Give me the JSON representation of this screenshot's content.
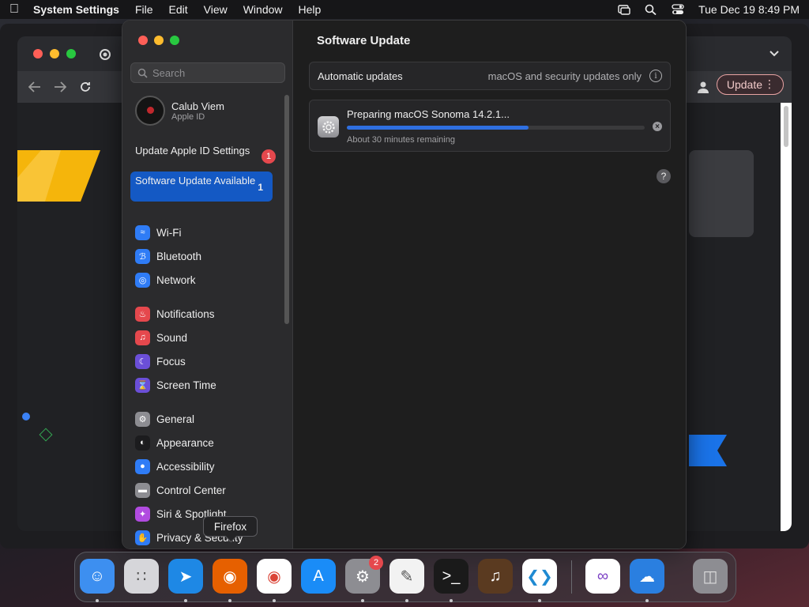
{
  "menubar": {
    "app_name": "System Settings",
    "menus": [
      "File",
      "Edit",
      "View",
      "Window",
      "Help"
    ],
    "datetime": "Tue Dec 19  8:49 PM"
  },
  "chrome": {
    "update_label": "Update"
  },
  "settings": {
    "search_placeholder": "Search",
    "account": {
      "name": "Calub Viem",
      "subtitle": "Apple ID"
    },
    "alerts": [
      {
        "label": "Update Apple ID Settings",
        "count": "1"
      },
      {
        "label": "Software Update Available",
        "count": "1"
      }
    ],
    "nav_groups": [
      [
        {
          "label": "Wi-Fi",
          "icon": "wifi-icon",
          "color": "#2f7cf6"
        },
        {
          "label": "Bluetooth",
          "icon": "bluetooth-icon",
          "color": "#2f7cf6"
        },
        {
          "label": "Network",
          "icon": "globe-icon",
          "color": "#2f7cf6"
        }
      ],
      [
        {
          "label": "Notifications",
          "icon": "bell-icon",
          "color": "#e5484d"
        },
        {
          "label": "Sound",
          "icon": "speaker-icon",
          "color": "#e5484d"
        },
        {
          "label": "Focus",
          "icon": "moon-icon",
          "color": "#6b4fd8"
        },
        {
          "label": "Screen Time",
          "icon": "hourglass-icon",
          "color": "#6b4fd8"
        }
      ],
      [
        {
          "label": "General",
          "icon": "gear-icon",
          "color": "#8d8d92"
        },
        {
          "label": "Appearance",
          "icon": "appearance-icon",
          "color": "#1c1c1e"
        },
        {
          "label": "Accessibility",
          "icon": "accessibility-icon",
          "color": "#2f7cf6"
        },
        {
          "label": "Control Center",
          "icon": "toggles-icon",
          "color": "#8d8d92"
        },
        {
          "label": "Siri & Spotlight",
          "icon": "siri-icon",
          "color": "#b14be0"
        },
        {
          "label": "Privacy & Security",
          "icon": "hand-icon",
          "color": "#2f7cf6"
        }
      ]
    ],
    "main": {
      "title": "Software Update",
      "auto_updates_label": "Automatic updates",
      "auto_updates_value": "macOS and security updates only",
      "progress_title": "Preparing macOS Sonoma 14.2.1...",
      "progress_fraction": 0.61,
      "progress_subtitle": "About 30 minutes remaining"
    }
  },
  "tooltip": "Firefox",
  "dock": {
    "apps": [
      {
        "name": "Finder",
        "icon": "finder-icon",
        "color": "#3d8ff0",
        "running": true
      },
      {
        "name": "Launchpad",
        "icon": "launchpad-icon",
        "color": "#d6d6da",
        "running": false
      },
      {
        "name": "Safari",
        "icon": "safari-icon",
        "color": "#1e88e5",
        "running": true
      },
      {
        "name": "Firefox",
        "icon": "firefox-icon",
        "color": "#e66000",
        "running": true
      },
      {
        "name": "Chrome",
        "icon": "chrome-icon",
        "color": "#ffffff",
        "running": true
      },
      {
        "name": "App Store",
        "icon": "appstore-icon",
        "color": "#1a8cf7",
        "running": false
      },
      {
        "name": "System Settings",
        "icon": "settings-icon",
        "color": "#8d8d92",
        "running": true,
        "badge": "2"
      },
      {
        "name": "TextEdit",
        "icon": "textedit-icon",
        "color": "#f2f2f2",
        "running": true
      },
      {
        "name": "Terminal",
        "icon": "terminal-icon",
        "color": "#1a1a1a",
        "running": true
      },
      {
        "name": "GarageBand",
        "icon": "garageband-icon",
        "color": "#5a3a20",
        "running": false
      },
      {
        "name": "Visual Studio Code",
        "icon": "vscode-icon",
        "color": "#ffffff",
        "running": true
      },
      {
        "name": "Visual Studio",
        "icon": "visualstudio-icon",
        "color": "#ffffff",
        "running": false
      },
      {
        "name": "Weather",
        "icon": "weather-icon",
        "color": "#2a7fe0",
        "running": true
      },
      {
        "name": "Trash",
        "icon": "trash-icon",
        "color": "#8d8d92",
        "running": false
      }
    ]
  }
}
